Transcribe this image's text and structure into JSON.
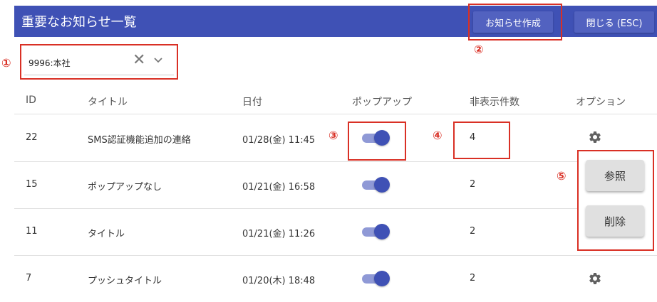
{
  "header": {
    "title": "重要なお知らせ一覧",
    "create_label": "お知らせ作成",
    "close_label": "閉じる (ESC)"
  },
  "filter": {
    "value": "9996:本社"
  },
  "table": {
    "columns": [
      "ID",
      "タイトル",
      "日付",
      "ポップアップ",
      "非表示件数",
      "オプション"
    ],
    "rows": [
      {
        "id": "22",
        "title": "SMS認証機能追加の連絡",
        "date": "01/28(金) 11:45",
        "popup": true,
        "hidden_count": "4"
      },
      {
        "id": "15",
        "title": "ポップアップなし",
        "date": "01/21(金) 16:58",
        "popup": true,
        "hidden_count": "2"
      },
      {
        "id": "11",
        "title": "タイトル",
        "date": "01/21(金) 11:26",
        "popup": true,
        "hidden_count": "2"
      },
      {
        "id": "7",
        "title": "プッシュタイトル",
        "date": "01/20(木) 18:48",
        "popup": true,
        "hidden_count": "2"
      }
    ]
  },
  "options_menu": {
    "view_label": "参照",
    "delete_label": "削除"
  },
  "annotations": [
    "①",
    "②",
    "③",
    "④",
    "⑤"
  ],
  "colors": {
    "primary": "#3f51b5",
    "annotation": "#d93025",
    "toggle_track": "#8f99d6"
  },
  "icons": {
    "clear": "close-icon",
    "dropdown": "chevron-down-icon",
    "options": "gear-icon"
  }
}
